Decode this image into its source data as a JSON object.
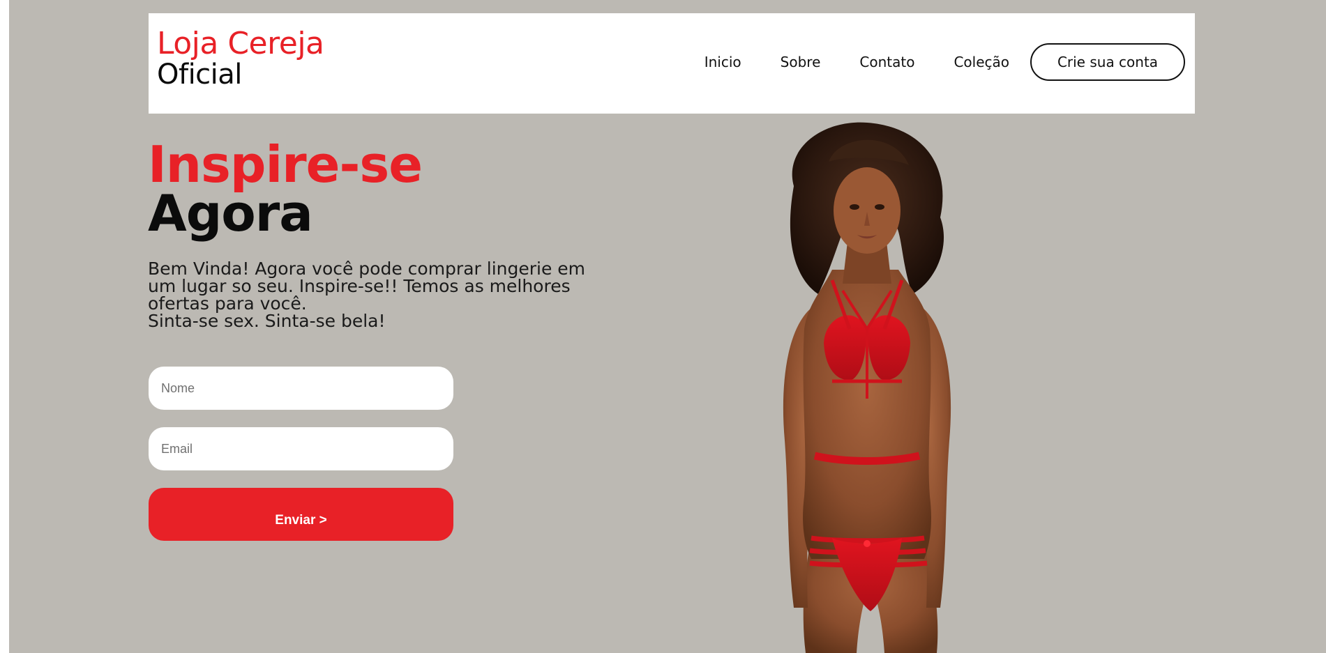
{
  "colors": {
    "accent": "#e82127",
    "page_background": "#bcb9b3",
    "header_background": "#ffffff",
    "text_dark": "#0b0b0b"
  },
  "header": {
    "logo": {
      "line1": "Loja Cereja",
      "line2": "Oficial"
    },
    "nav": {
      "items": [
        {
          "label": "Inicio"
        },
        {
          "label": "Sobre"
        },
        {
          "label": "Contato"
        },
        {
          "label": "Coleção"
        }
      ],
      "cta_label": "Crie sua conta"
    }
  },
  "hero": {
    "title_line1": "Inspire-se",
    "title_line2": "Agora",
    "description_lines": [
      "Bem Vinda! Agora você pode comprar lingerie em",
      "um lugar so seu. Inspire-se!! Temos as melhores",
      "ofertas para você.",
      "Sinta-se sex. Sinta-se bela!"
    ]
  },
  "form": {
    "name_placeholder": "Nome",
    "name_value": "",
    "email_placeholder": "Email",
    "email_value": "",
    "submit_label": "Enviar >"
  },
  "image": {
    "subject": "model-in-red-lingerie"
  }
}
